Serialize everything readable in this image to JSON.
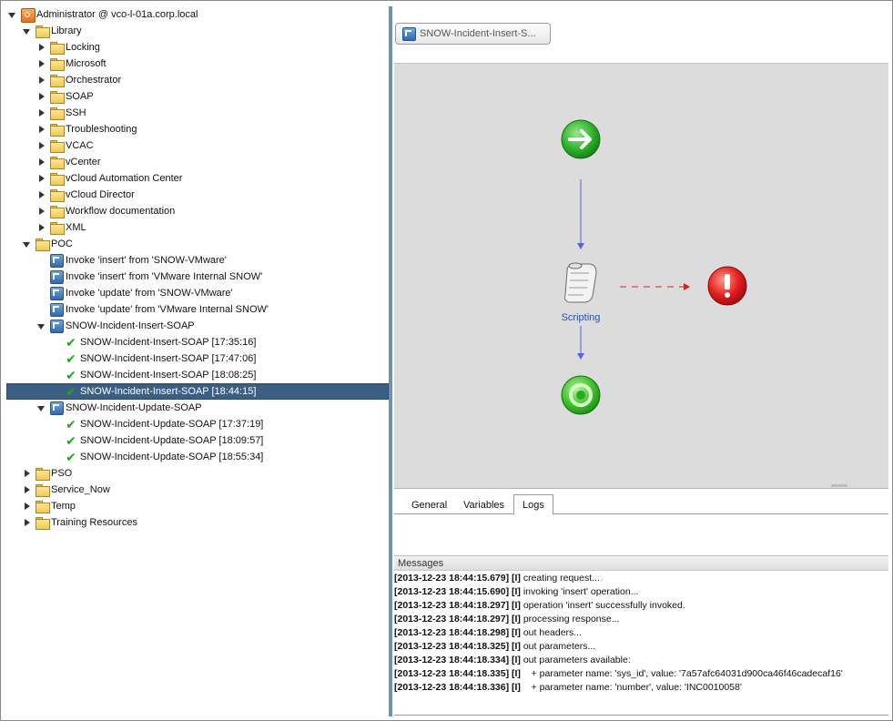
{
  "tree": {
    "rows": [
      {
        "label": "Administrator @ vco-l-01a.corp.local",
        "icon": "server-icon",
        "toggle": "expanded",
        "level": 0
      },
      {
        "label": "Library",
        "icon": "folder-icon",
        "toggle": "expanded",
        "level": 1
      },
      {
        "label": "Locking",
        "icon": "folder-icon",
        "toggle": "collapsed",
        "level": 2
      },
      {
        "label": "Microsoft",
        "icon": "folder-icon",
        "toggle": "collapsed",
        "level": 2
      },
      {
        "label": "Orchestrator",
        "icon": "folder-icon",
        "toggle": "collapsed",
        "level": 2
      },
      {
        "label": "SOAP",
        "icon": "folder-icon",
        "toggle": "collapsed",
        "level": 2
      },
      {
        "label": "SSH",
        "icon": "folder-icon",
        "toggle": "collapsed",
        "level": 2
      },
      {
        "label": "Troubleshooting",
        "icon": "folder-icon",
        "toggle": "collapsed",
        "level": 2
      },
      {
        "label": "VCAC",
        "icon": "folder-icon",
        "toggle": "collapsed",
        "level": 2
      },
      {
        "label": "vCenter",
        "icon": "folder-icon",
        "toggle": "collapsed",
        "level": 2
      },
      {
        "label": "vCloud Automation Center",
        "icon": "folder-icon",
        "toggle": "collapsed",
        "level": 2
      },
      {
        "label": "vCloud Director",
        "icon": "folder-icon",
        "toggle": "collapsed",
        "level": 2
      },
      {
        "label": "Workflow documentation",
        "icon": "folder-icon",
        "toggle": "collapsed",
        "level": 2
      },
      {
        "label": "XML",
        "icon": "folder-icon",
        "toggle": "collapsed",
        "level": 2
      },
      {
        "label": "POC",
        "icon": "folder-icon",
        "toggle": "expanded",
        "level": 1
      },
      {
        "label": "Invoke 'insert' from 'SNOW-VMware'",
        "icon": "workflow-icon",
        "toggle": "none",
        "level": 2
      },
      {
        "label": "Invoke 'insert' from 'VMware Internal SNOW'",
        "icon": "workflow-icon",
        "toggle": "none",
        "level": 2
      },
      {
        "label": "Invoke 'update' from 'SNOW-VMware'",
        "icon": "workflow-icon",
        "toggle": "none",
        "level": 2
      },
      {
        "label": "Invoke 'update' from 'VMware Internal SNOW'",
        "icon": "workflow-icon",
        "toggle": "none",
        "level": 2
      },
      {
        "label": "SNOW-Incident-Insert-SOAP",
        "icon": "workflow-icon",
        "toggle": "expanded",
        "level": 2
      },
      {
        "label": "SNOW-Incident-Insert-SOAP [17:35:16]",
        "icon": "checkmark-icon",
        "toggle": "none",
        "level": 3
      },
      {
        "label": "SNOW-Incident-Insert-SOAP [17:47:06]",
        "icon": "checkmark-icon",
        "toggle": "none",
        "level": 3
      },
      {
        "label": "SNOW-Incident-Insert-SOAP [18:08:25]",
        "icon": "checkmark-icon",
        "toggle": "none",
        "level": 3
      },
      {
        "label": "SNOW-Incident-Insert-SOAP [18:44:15]",
        "icon": "checkmark-icon",
        "toggle": "none",
        "level": 3,
        "selected": true
      },
      {
        "label": "SNOW-Incident-Update-SOAP",
        "icon": "workflow-icon",
        "toggle": "expanded",
        "level": 2
      },
      {
        "label": "SNOW-Incident-Update-SOAP [17:37:19]",
        "icon": "checkmark-icon",
        "toggle": "none",
        "level": 3
      },
      {
        "label": "SNOW-Incident-Update-SOAP [18:09:57]",
        "icon": "checkmark-icon",
        "toggle": "none",
        "level": 3
      },
      {
        "label": "SNOW-Incident-Update-SOAP [18:55:34]",
        "icon": "checkmark-icon",
        "toggle": "none",
        "level": 3
      },
      {
        "label": "PSO",
        "icon": "folder-icon",
        "toggle": "collapsed",
        "level": 1
      },
      {
        "label": "Service_Now",
        "icon": "folder-icon",
        "toggle": "collapsed",
        "level": 1
      },
      {
        "label": "Temp",
        "icon": "folder-icon",
        "toggle": "collapsed",
        "level": 1
      },
      {
        "label": "Training Resources",
        "icon": "folder-icon",
        "toggle": "collapsed",
        "level": 1
      }
    ]
  },
  "editor": {
    "workflow_tab_label": "SNOW-Incident-Insert-S...",
    "schema": {
      "scripting_label": "Scripting",
      "start_color": "#2bb32b",
      "error_color": "#e21b1b",
      "link_color": "#5566dd"
    },
    "tabs": [
      {
        "label": "General",
        "active": false
      },
      {
        "label": "Variables",
        "active": false
      },
      {
        "label": "Logs",
        "active": true
      }
    ],
    "messages_header": "Messages",
    "logs": [
      {
        "ts": "[2013-12-23 18:44:15.679] [I]",
        "msg": " creating request..."
      },
      {
        "ts": "[2013-12-23 18:44:15.690] [I]",
        "msg": " invoking 'insert' operation..."
      },
      {
        "ts": "[2013-12-23 18:44:18.297] [I]",
        "msg": " operation 'insert' successfully invoked."
      },
      {
        "ts": "[2013-12-23 18:44:18.297] [I]",
        "msg": " processing response..."
      },
      {
        "ts": "[2013-12-23 18:44:18.298] [I]",
        "msg": " out headers..."
      },
      {
        "ts": "[2013-12-23 18:44:18.325] [I]",
        "msg": " out parameters..."
      },
      {
        "ts": "[2013-12-23 18:44:18.334] [I]",
        "msg": " out parameters available:"
      },
      {
        "ts": "[2013-12-23 18:44:18.335] [I]",
        "msg": "    + parameter name: 'sys_id', value: '7a57afc64031d900ca46f46cadecaf16'"
      },
      {
        "ts": "[2013-12-23 18:44:18.336] [I]",
        "msg": "    + parameter name: 'number', value: 'INC0010058'"
      }
    ]
  }
}
